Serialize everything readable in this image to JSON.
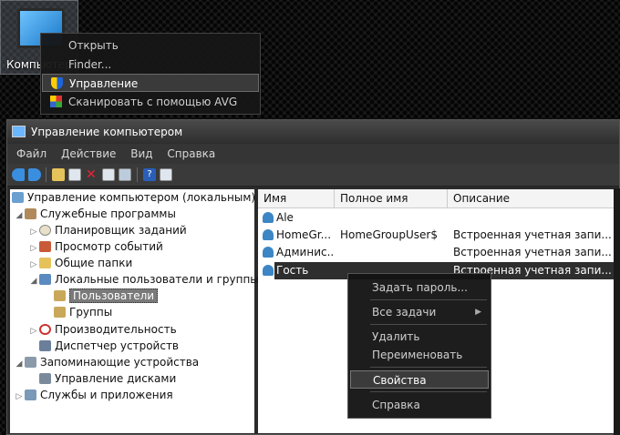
{
  "desktop": {
    "icon_label": "Компьютер"
  },
  "desktop_menu": {
    "items": [
      {
        "label": "Открыть"
      },
      {
        "label": "Finder..."
      },
      {
        "label": "Управление"
      },
      {
        "label": "Сканировать с помощью AVG"
      }
    ],
    "highlighted": "Управление"
  },
  "window": {
    "title": "Управление компьютером",
    "menu": [
      "Файл",
      "Действие",
      "Вид",
      "Справка"
    ]
  },
  "tree": {
    "nodes": [
      {
        "label": "Управление компьютером (локальным)"
      },
      {
        "label": "Служебные программы"
      },
      {
        "label": "Планировщик заданий"
      },
      {
        "label": "Просмотр событий"
      },
      {
        "label": "Общие папки"
      },
      {
        "label": "Локальные пользователи и группы"
      },
      {
        "label": "Пользователи"
      },
      {
        "label": "Группы"
      },
      {
        "label": "Производительность"
      },
      {
        "label": "Диспетчер устройств"
      },
      {
        "label": "Запоминающие устройства"
      },
      {
        "label": "Управление дисками"
      },
      {
        "label": "Службы и приложения"
      }
    ],
    "selected": "Пользователи"
  },
  "list": {
    "columns": [
      "Имя",
      "Полное имя",
      "Описание"
    ],
    "rows": [
      {
        "name": "Ale",
        "full_name": "",
        "description": ""
      },
      {
        "name": "HomeGr...",
        "full_name": "HomeGroupUser$",
        "description": "Встроенная учетная запи..."
      },
      {
        "name": "Админис...",
        "full_name": "",
        "description": "Встроенная учетная запи..."
      },
      {
        "name": "Гость",
        "full_name": "",
        "description": "Встроенная учетная запи..."
      }
    ],
    "selected": "Гость"
  },
  "user_menu": {
    "items": [
      {
        "label": "Задать пароль..."
      },
      {
        "label": "Все задачи"
      },
      {
        "label": "Удалить"
      },
      {
        "label": "Переименовать"
      },
      {
        "label": "Свойства"
      },
      {
        "label": "Справка"
      }
    ],
    "highlighted": "Свойства"
  }
}
